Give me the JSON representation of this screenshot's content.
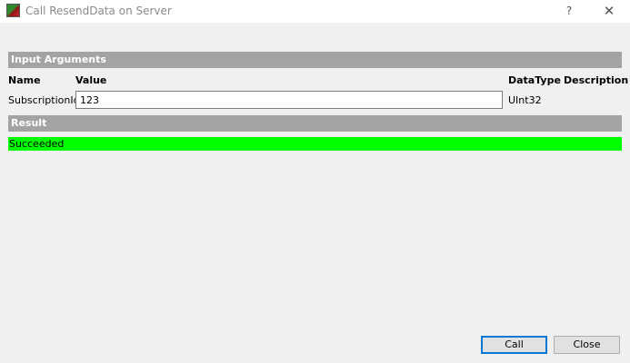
{
  "window": {
    "title": "Call ResendData on Server",
    "help_label": "?",
    "close_label": "✕"
  },
  "input_section": {
    "header": "Input Arguments",
    "columns": {
      "name": "Name",
      "value": "Value",
      "datatype": "DataType",
      "description": "Description"
    },
    "arguments": [
      {
        "name": "SubscriptionId",
        "value": "123",
        "datatype": "UInt32",
        "description": ""
      }
    ]
  },
  "result_section": {
    "header": "Result",
    "status": "Succeeded",
    "status_color": "#00ff00"
  },
  "buttons": {
    "call_label": "Call",
    "close_label": "Close"
  },
  "colors": {
    "section_bar": "#a3a3a3",
    "default_button_border": "#0078d7"
  },
  "icons": {
    "app": "app-icon",
    "help": "help-icon",
    "close": "close-icon"
  }
}
